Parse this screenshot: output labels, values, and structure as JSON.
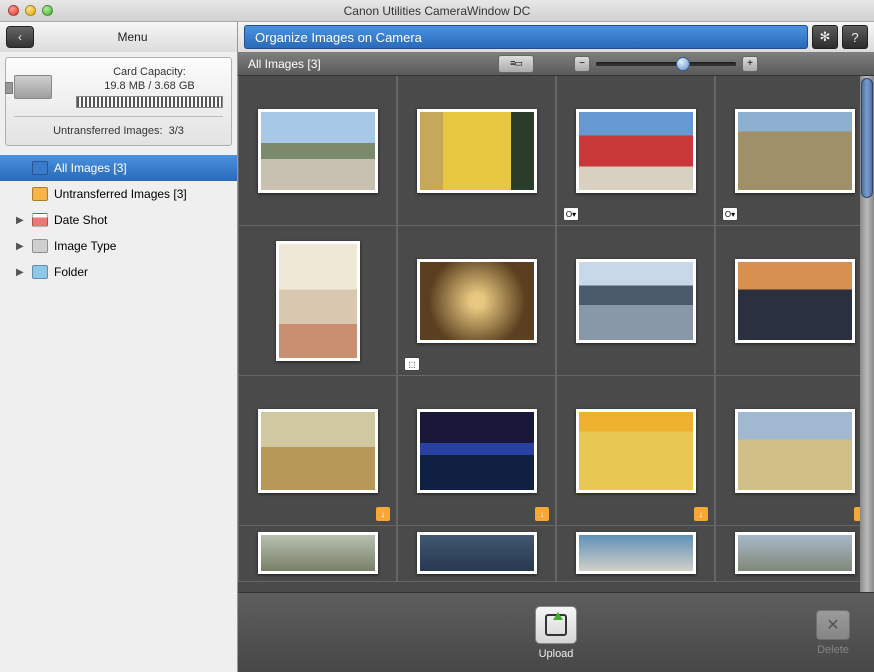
{
  "window": {
    "title": "Canon Utilities CameraWindow DC"
  },
  "toolbar": {
    "menu_label": "Menu",
    "organize_title": "Organize Images on Camera"
  },
  "card": {
    "capacity_label": "Card Capacity:",
    "capacity_value": "19.8 MB / 3.68 GB",
    "untransferred_label": "Untransferred Images:",
    "untransferred_value": "3/3"
  },
  "tree": {
    "all_images": "All Images [3]",
    "untransferred": "Untransferred Images [3]",
    "date_shot": "Date Shot",
    "image_type": "Image Type",
    "folder": "Folder"
  },
  "subheader": {
    "label": "All Images [3]"
  },
  "bottom": {
    "upload": "Upload",
    "delete": "Delete"
  },
  "thumbs": [
    {
      "orient": "landscape",
      "bg": "linear-gradient(#a8c8e8 40%, #7a8a6a 40% 60%, #c8c0b0 60%)",
      "badge": "",
      "flag": false
    },
    {
      "orient": "landscape",
      "bg": "linear-gradient(90deg, #c7a85a 20%, #e8c840 20% 80%, #2a3c2a 80%)",
      "badge": "",
      "flag": false
    },
    {
      "orient": "landscape",
      "bg": "linear-gradient(#6698d2 30%, #c83838 30% 70%, #d8d0c0 70%)",
      "badge": "O▾",
      "flag": false
    },
    {
      "orient": "landscape",
      "bg": "linear-gradient(#8eb0d0 25%, #a0906a 25%)",
      "badge": "O▾",
      "flag": false
    },
    {
      "orient": "portrait",
      "bg": "linear-gradient(#f0e8d6 40%, #d8c8b0 40% 70%, #c89070 70%)",
      "badge": "",
      "flag": false
    },
    {
      "orient": "landscape",
      "bg": "radial-gradient(circle, #e8c880 10%, #5a4020 70%)",
      "badge": "⬚",
      "flag": false
    },
    {
      "orient": "landscape",
      "bg": "linear-gradient(#c8d8e8 30%, #4a5a6a 30% 55%, #8898a8 55%)",
      "badge": "",
      "flag": false
    },
    {
      "orient": "landscape",
      "bg": "linear-gradient(#d89050 35%, #2a3040 35%)",
      "badge": "",
      "flag": false
    },
    {
      "orient": "landscape",
      "bg": "linear-gradient(#d0c8a0 45%, #b89858 45%)",
      "badge": "",
      "flag": true
    },
    {
      "orient": "landscape",
      "bg": "linear-gradient(#1a1838 40%, #2840a0 40% 55%, #102040 55%)",
      "badge": "",
      "flag": true
    },
    {
      "orient": "landscape",
      "bg": "linear-gradient(#f0b030 25%, #e8c850 25%)",
      "badge": "",
      "flag": true
    },
    {
      "orient": "landscape",
      "bg": "linear-gradient(#a0b8d0 35%, #d0c088 35%)",
      "badge": "",
      "flag": true
    },
    {
      "orient": "landscape",
      "bg": "linear-gradient(#b8c0b0, #788068)",
      "badge": "",
      "flag": false
    },
    {
      "orient": "landscape",
      "bg": "linear-gradient(#405870, #283850)",
      "badge": "",
      "flag": false
    },
    {
      "orient": "landscape",
      "bg": "linear-gradient(#6090b8, #d0d0c8)",
      "badge": "",
      "flag": false
    },
    {
      "orient": "landscape",
      "bg": "linear-gradient(#a8b8c8, #808878)",
      "badge": "",
      "flag": false
    }
  ]
}
